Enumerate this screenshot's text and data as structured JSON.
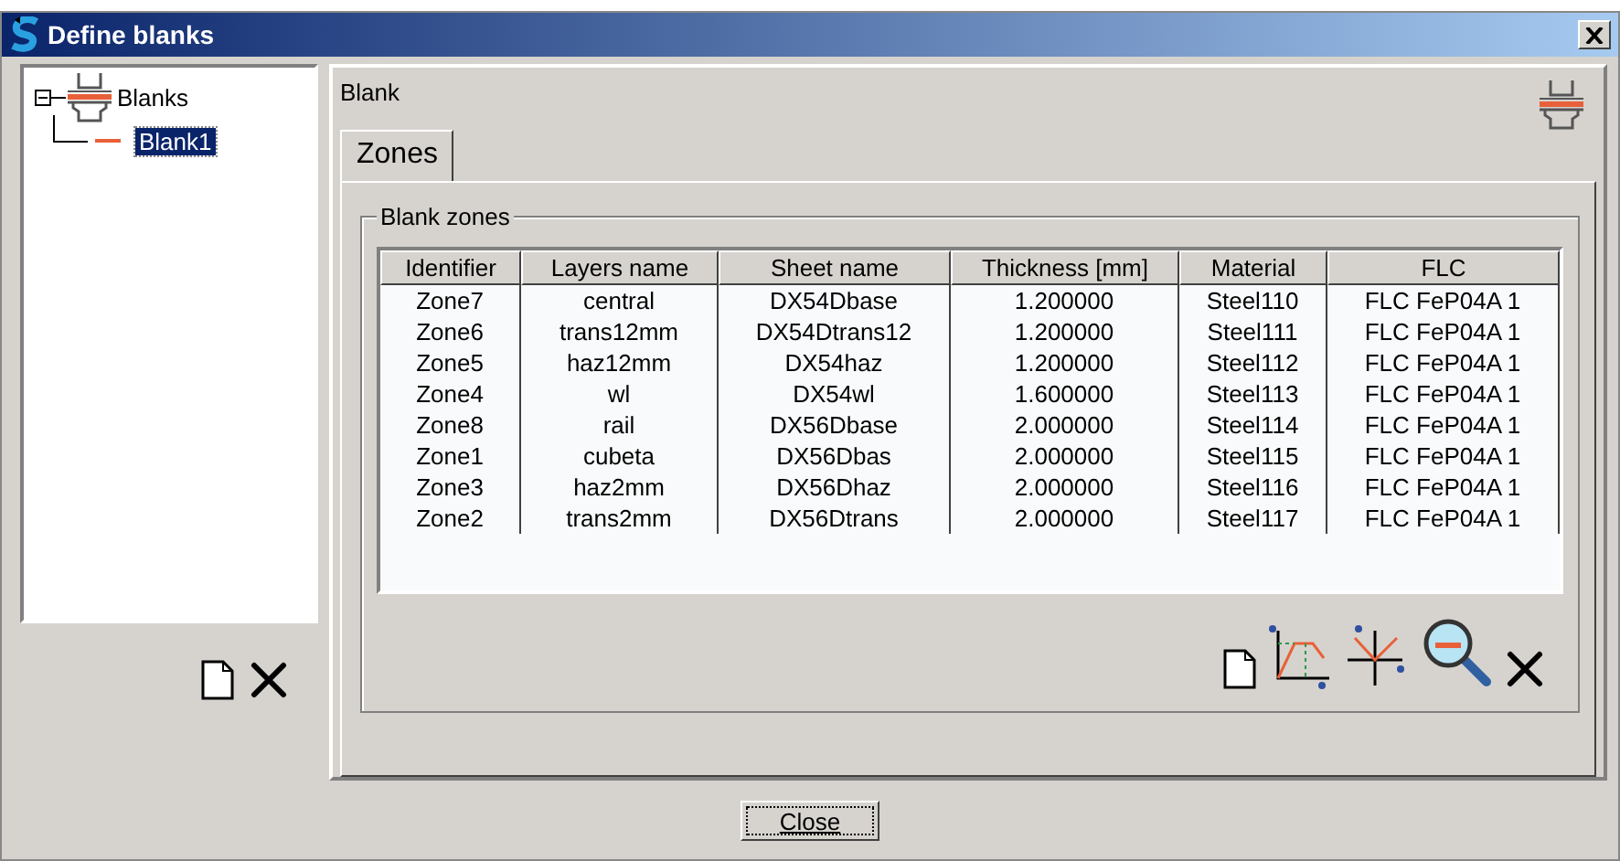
{
  "window": {
    "title": "Define blanks"
  },
  "tree": [
    {
      "label": "Blanks",
      "expanded": true,
      "selected": false,
      "children": [
        {
          "label": "Blank1",
          "selected": true
        }
      ]
    }
  ],
  "panel": {
    "title": "Blank"
  },
  "tabs": [
    {
      "label": "Zones",
      "selected": true
    }
  ],
  "group": {
    "title": "Blank zones"
  },
  "table": {
    "columns": [
      "Identifier",
      "Layers name",
      "Sheet name",
      "Thickness [mm]",
      "Material",
      "FLC"
    ],
    "rows": [
      [
        "Zone7",
        "central",
        "DX54Dbase",
        "1.200000",
        "Steel110",
        "FLC FeP04A 1"
      ],
      [
        "Zone6",
        "trans12mm",
        "DX54Dtrans12",
        "1.200000",
        "Steel111",
        "FLC FeP04A 1"
      ],
      [
        "Zone5",
        "haz12mm",
        "DX54haz",
        "1.200000",
        "Steel112",
        "FLC FeP04A 1"
      ],
      [
        "Zone4",
        "wl",
        "DX54wl",
        "1.600000",
        "Steel113",
        "FLC FeP04A 1"
      ],
      [
        "Zone8",
        "rail",
        "DX56Dbase",
        "2.000000",
        "Steel114",
        "FLC FeP04A 1"
      ],
      [
        "Zone1",
        "cubeta",
        "DX56Dbas",
        "2.000000",
        "Steel115",
        "FLC FeP04A 1"
      ],
      [
        "Zone3",
        "haz2mm",
        "DX56Dhaz",
        "2.000000",
        "Steel116",
        "FLC FeP04A 1"
      ],
      [
        "Zone2",
        "trans2mm",
        "DX56Dtrans",
        "2.000000",
        "Steel117",
        "FLC FeP04A 1"
      ]
    ]
  },
  "buttons": [
    {
      "label": "Close"
    }
  ]
}
